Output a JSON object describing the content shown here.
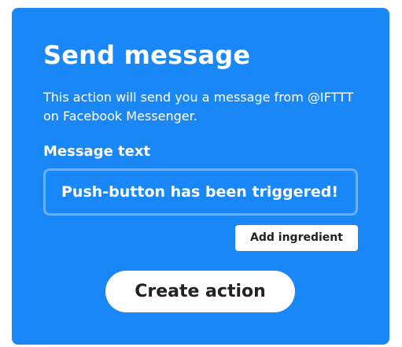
{
  "card": {
    "title": "Send message",
    "description": "This action will send you a message from @IFTTT on Facebook Messenger.",
    "field_label": "Message text",
    "message_value": "Push-button has been triggered!",
    "add_ingredient_label": "Add ingredient",
    "create_action_label": "Create action"
  },
  "colors": {
    "card_background": "#1a87f6",
    "input_border": "#69b0ff",
    "button_background": "#ffffff",
    "button_text": "#222222"
  }
}
